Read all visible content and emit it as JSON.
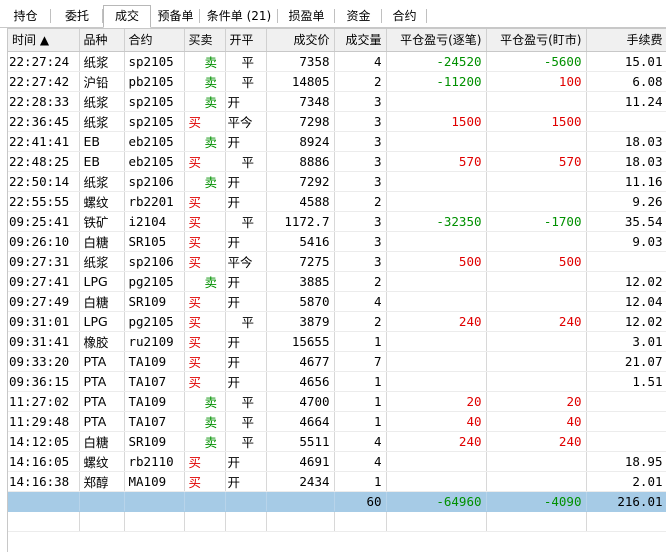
{
  "tabs": [
    {
      "label": "持仓",
      "active": false
    },
    {
      "label": "委托",
      "active": false
    },
    {
      "label": "成交",
      "active": true
    },
    {
      "label": "预备单",
      "active": false
    },
    {
      "label": "条件单 (21)",
      "active": false
    },
    {
      "label": "损盈单",
      "active": false
    },
    {
      "label": "资金",
      "active": false
    },
    {
      "label": "合约",
      "active": false
    }
  ],
  "columns": {
    "time": "时间 ▲",
    "product": "品种",
    "contract": "合约",
    "direction": "买卖",
    "open_close": "开平",
    "price": "成交价",
    "volume": "成交量",
    "pnl_trade": "平仓盈亏(逐笔)",
    "pnl_mark": "平仓盈亏(盯市)",
    "fee": "手续费"
  },
  "rows": [
    {
      "time": "22:27:24",
      "product": "纸浆",
      "contract": "sp2105",
      "direction": "卖",
      "open_close": "平",
      "price": "7358",
      "volume": "4",
      "pnl_trade": "-24520",
      "pnl_mark": "-5600",
      "fee": "15.01"
    },
    {
      "time": "22:27:42",
      "product": "沪铅",
      "contract": "pb2105",
      "direction": "卖",
      "open_close": "平",
      "price": "14805",
      "volume": "2",
      "pnl_trade": "-11200",
      "pnl_mark": "100",
      "fee": "6.08"
    },
    {
      "time": "22:28:33",
      "product": "纸浆",
      "contract": "sp2105",
      "direction": "卖",
      "open_close": "开",
      "price": "7348",
      "volume": "3",
      "pnl_trade": "",
      "pnl_mark": "",
      "fee": "11.24"
    },
    {
      "time": "22:36:45",
      "product": "纸浆",
      "contract": "sp2105",
      "direction": "买",
      "open_close": "平今",
      "price": "7298",
      "volume": "3",
      "pnl_trade": "1500",
      "pnl_mark": "1500",
      "fee": ""
    },
    {
      "time": "22:41:41",
      "product": "EB",
      "contract": "eb2105",
      "direction": "卖",
      "open_close": "开",
      "price": "8924",
      "volume": "3",
      "pnl_trade": "",
      "pnl_mark": "",
      "fee": "18.03"
    },
    {
      "time": "22:48:25",
      "product": "EB",
      "contract": "eb2105",
      "direction": "买",
      "open_close": "平",
      "price": "8886",
      "volume": "3",
      "pnl_trade": "570",
      "pnl_mark": "570",
      "fee": "18.03"
    },
    {
      "time": "22:50:14",
      "product": "纸浆",
      "contract": "sp2106",
      "direction": "卖",
      "open_close": "开",
      "price": "7292",
      "volume": "3",
      "pnl_trade": "",
      "pnl_mark": "",
      "fee": "11.16"
    },
    {
      "time": "22:55:55",
      "product": "螺纹",
      "contract": "rb2201",
      "direction": "买",
      "open_close": "开",
      "price": "4588",
      "volume": "2",
      "pnl_trade": "",
      "pnl_mark": "",
      "fee": "9.26"
    },
    {
      "time": "09:25:41",
      "product": "铁矿",
      "contract": "i2104",
      "direction": "买",
      "open_close": "平",
      "price": "1172.7",
      "volume": "3",
      "pnl_trade": "-32350",
      "pnl_mark": "-1700",
      "fee": "35.54"
    },
    {
      "time": "09:26:10",
      "product": "白糖",
      "contract": "SR105",
      "direction": "买",
      "open_close": "开",
      "price": "5416",
      "volume": "3",
      "pnl_trade": "",
      "pnl_mark": "",
      "fee": "9.03"
    },
    {
      "time": "09:27:31",
      "product": "纸浆",
      "contract": "sp2106",
      "direction": "买",
      "open_close": "平今",
      "price": "7275",
      "volume": "3",
      "pnl_trade": "500",
      "pnl_mark": "500",
      "fee": ""
    },
    {
      "time": "09:27:41",
      "product": "LPG",
      "contract": "pg2105",
      "direction": "卖",
      "open_close": "开",
      "price": "3885",
      "volume": "2",
      "pnl_trade": "",
      "pnl_mark": "",
      "fee": "12.02"
    },
    {
      "time": "09:27:49",
      "product": "白糖",
      "contract": "SR109",
      "direction": "买",
      "open_close": "开",
      "price": "5870",
      "volume": "4",
      "pnl_trade": "",
      "pnl_mark": "",
      "fee": "12.04"
    },
    {
      "time": "09:31:01",
      "product": "LPG",
      "contract": "pg2105",
      "direction": "买",
      "open_close": "平",
      "price": "3879",
      "volume": "2",
      "pnl_trade": "240",
      "pnl_mark": "240",
      "fee": "12.02"
    },
    {
      "time": "09:31:41",
      "product": "橡胶",
      "contract": "ru2109",
      "direction": "买",
      "open_close": "开",
      "price": "15655",
      "volume": "1",
      "pnl_trade": "",
      "pnl_mark": "",
      "fee": "3.01"
    },
    {
      "time": "09:33:20",
      "product": "PTA",
      "contract": "TA109",
      "direction": "买",
      "open_close": "开",
      "price": "4677",
      "volume": "7",
      "pnl_trade": "",
      "pnl_mark": "",
      "fee": "21.07"
    },
    {
      "time": "09:36:15",
      "product": "PTA",
      "contract": "TA107",
      "direction": "买",
      "open_close": "开",
      "price": "4656",
      "volume": "1",
      "pnl_trade": "",
      "pnl_mark": "",
      "fee": "1.51"
    },
    {
      "time": "11:27:02",
      "product": "PTA",
      "contract": "TA109",
      "direction": "卖",
      "open_close": "平",
      "price": "4700",
      "volume": "1",
      "pnl_trade": "20",
      "pnl_mark": "20",
      "fee": ""
    },
    {
      "time": "11:29:48",
      "product": "PTA",
      "contract": "TA107",
      "direction": "卖",
      "open_close": "平",
      "price": "4664",
      "volume": "1",
      "pnl_trade": "40",
      "pnl_mark": "40",
      "fee": ""
    },
    {
      "time": "14:12:05",
      "product": "白糖",
      "contract": "SR109",
      "direction": "卖",
      "open_close": "平",
      "price": "5511",
      "volume": "4",
      "pnl_trade": "240",
      "pnl_mark": "240",
      "fee": ""
    },
    {
      "time": "14:16:05",
      "product": "螺纹",
      "contract": "rb2110",
      "direction": "买",
      "open_close": "开",
      "price": "4691",
      "volume": "4",
      "pnl_trade": "",
      "pnl_mark": "",
      "fee": "18.95"
    },
    {
      "time": "14:16:38",
      "product": "郑醇",
      "contract": "MA109",
      "direction": "买",
      "open_close": "开",
      "price": "2434",
      "volume": "1",
      "pnl_trade": "",
      "pnl_mark": "",
      "fee": "2.01"
    }
  ],
  "totals": {
    "volume": "60",
    "pnl_trade": "-64960",
    "pnl_mark": "-4090",
    "fee": "216.01"
  },
  "colors": {
    "buy": "#e00000",
    "sell": "#009000",
    "total_row_bg": "#a6cbe6",
    "header_bg": "#f0f0f0"
  }
}
